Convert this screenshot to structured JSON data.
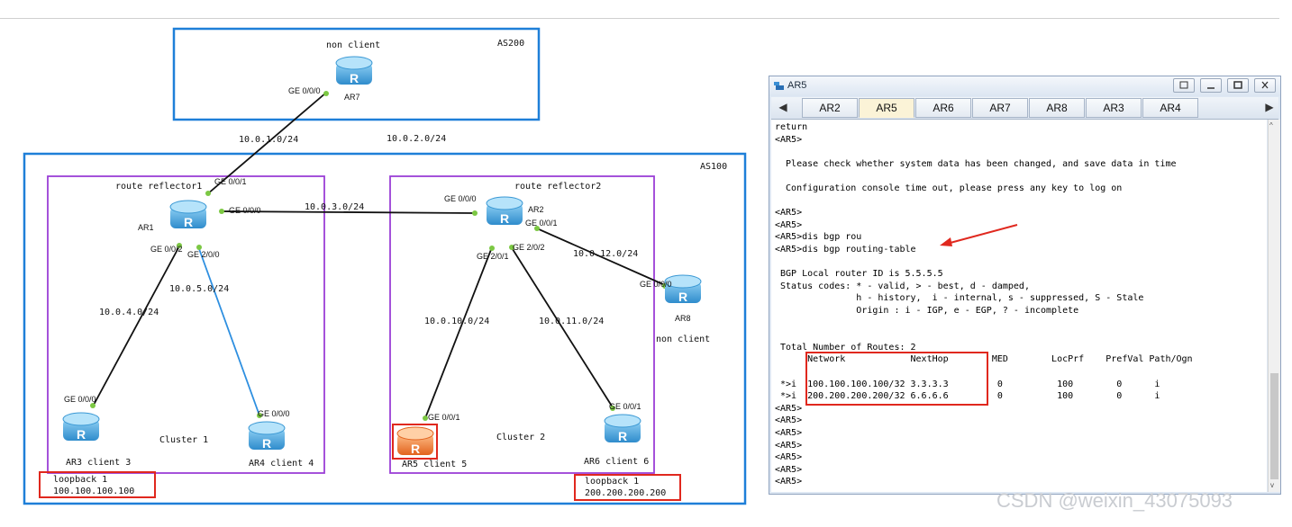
{
  "topology": {
    "as200_label": "AS200",
    "as100_label": "AS100",
    "non_client_top": "non client",
    "ar7": "AR7",
    "ar7_if": "GE 0/0/0",
    "rr1_label": "route reflector1",
    "rr2_label": "route reflector2",
    "ar1": "AR1",
    "ar2": "AR2",
    "ar8": "AR8",
    "ar8_label": "non client",
    "ar1_if_top": "GE 0/0/1",
    "ar1_if_right": "GE 0/0/0",
    "ar1_if_left": "GE 0/0/2",
    "ar1_if_down": "GE 2/0/0",
    "ar2_if_left": "GE 0/0/0",
    "ar2_if_right": "GE 0/0/1",
    "ar2_if_down1": "GE 2/0/1",
    "ar2_if_down2": "GE 2/0/2",
    "ar8_if": "GE 0/0/0",
    "ar3_if": "GE 0/0/0",
    "ar4_if": "GE 0/0/0",
    "ar5_if": "GE 0/0/1",
    "ar6_if": "GE 0/0/1",
    "ar3_label": "AR3 client 3",
    "ar4_label": "AR4 client 4",
    "ar5_label": "AR5 client 5",
    "ar6_label": "AR6 client 6",
    "cluster1": "Cluster 1",
    "cluster2": "Cluster 2",
    "net_ar7_ar1": "10.0.1.0/24",
    "net_ar7_ar2": "10.0.2.0/24",
    "net_ar1_ar2": "10.0.3.0/24",
    "net_ar1_ar3": "10.0.4.0/24",
    "net_ar1_ar4": "10.0.5.0/24",
    "net_ar2_ar5": "10.0.10.0/24",
    "net_ar2_ar6": "10.0.11.0/24",
    "net_ar2_ar8": "10.0.12.0/24",
    "loopback_left_title": "loopback 1",
    "loopback_left_ip": "100.100.100.100",
    "loopback_right_title": "loopback 1",
    "loopback_right_ip": "200.200.200.200",
    "router_glyph": "R"
  },
  "window": {
    "title": "AR5",
    "tabs": [
      "AR2",
      "AR5",
      "AR6",
      "AR7",
      "AR8",
      "AR3",
      "AR4"
    ],
    "active_tab": "AR5",
    "console_lines": [
      "return",
      "<AR5>",
      "",
      "  Please check whether system data has been changed, and save data in time",
      "",
      "  Configuration console time out, please press any key to log on",
      "",
      "<AR5>",
      "<AR5>",
      "<AR5>dis bgp rou",
      "<AR5>dis bgp routing-table",
      "",
      " BGP Local router ID is 5.5.5.5",
      " Status codes: * - valid, > - best, d - damped,",
      "               h - history,  i - internal, s - suppressed, S - Stale",
      "               Origin : i - IGP, e - EGP, ? - incomplete",
      "",
      "",
      " Total Number of Routes: 2",
      "      Network            NextHop        MED        LocPrf    PrefVal Path/Ogn",
      "",
      " *>i  100.100.100.100/32 3.3.3.3         0          100        0      i",
      " *>i  200.200.200.200/32 6.6.6.6         0          100        0      i",
      "<AR5>",
      "<AR5>",
      "<AR5>",
      "<AR5>",
      "<AR5>",
      "<AR5>",
      "<AR5>"
    ]
  },
  "watermark": "CSDN @weixin_43075093",
  "colors": {
    "as_border": "#1e7fd8",
    "cluster_border": "#9b3fd6",
    "highlight": "#e0281e",
    "link_blue": "#2e8fe0",
    "router_blue": "#4aa6dc",
    "router_orange": "#f0823a"
  }
}
